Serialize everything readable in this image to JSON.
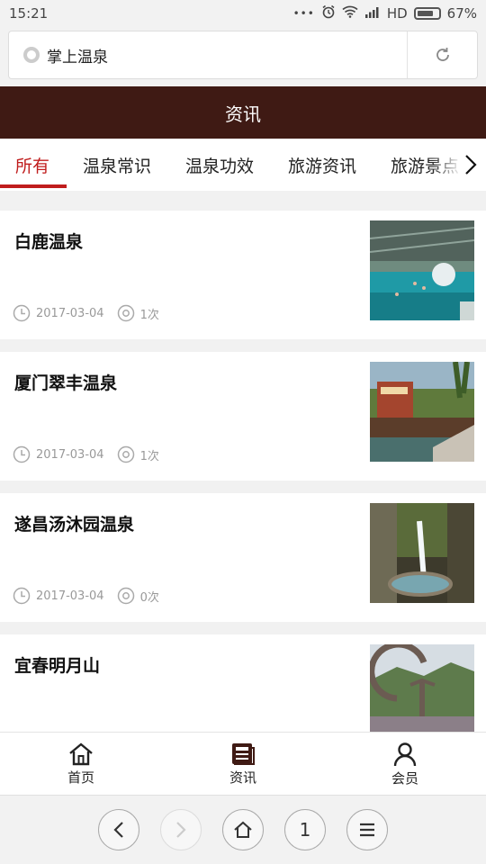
{
  "status_bar": {
    "time": "15:21",
    "dots": "•••",
    "network": "HD",
    "battery": "67%"
  },
  "address_bar": {
    "text": "掌上温泉"
  },
  "header": {
    "title": "资讯"
  },
  "tabs": [
    {
      "label": "所有",
      "active": true
    },
    {
      "label": "温泉常识",
      "active": false
    },
    {
      "label": "温泉功效",
      "active": false
    },
    {
      "label": "旅游资讯",
      "active": false
    },
    {
      "label": "旅游景点",
      "active": false
    }
  ],
  "articles": [
    {
      "title": "白鹿温泉",
      "date": "2017-03-04",
      "views": "1次"
    },
    {
      "title": "厦门翠丰温泉",
      "date": "2017-03-04",
      "views": "1次"
    },
    {
      "title": "遂昌汤沐园温泉",
      "date": "2017-03-04",
      "views": "0次"
    },
    {
      "title": "宜春明月山",
      "date": "",
      "views": ""
    }
  ],
  "bottom_nav": [
    {
      "label": "首页",
      "icon": "home-icon"
    },
    {
      "label": "资讯",
      "icon": "news-icon"
    },
    {
      "label": "会员",
      "icon": "member-icon"
    }
  ],
  "browser_toolbar": {
    "tab_count": "1"
  },
  "colors": {
    "header_bg": "#3f1a14",
    "accent": "#c01d1d",
    "meta_text": "#999999"
  }
}
